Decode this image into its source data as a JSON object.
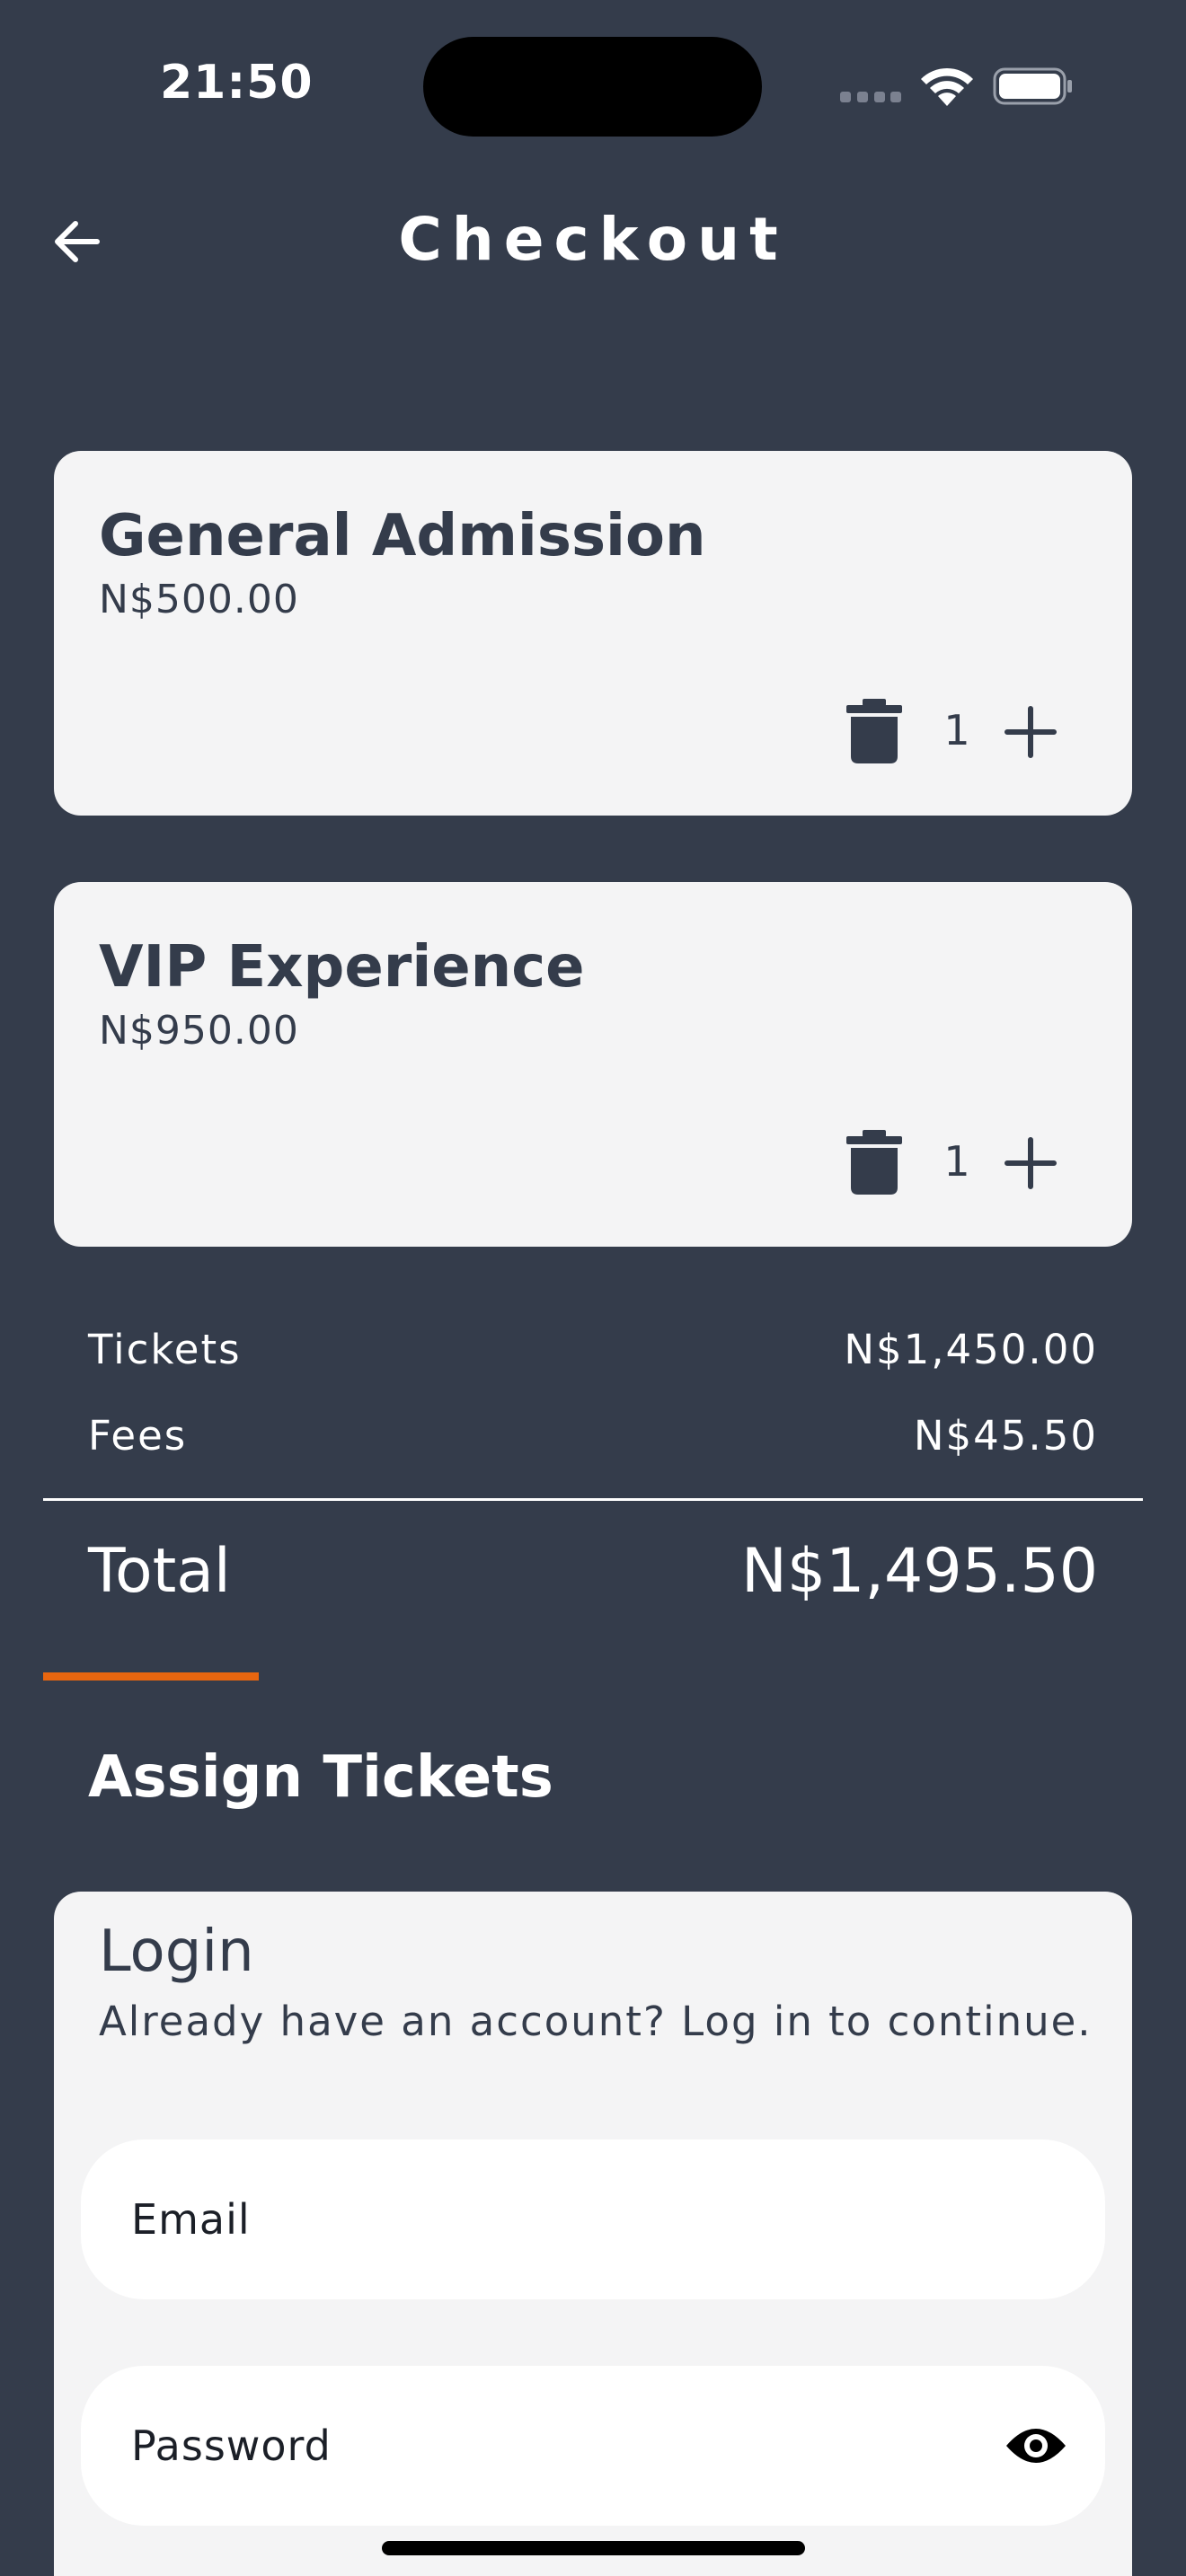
{
  "status_bar": {
    "time": "21:50"
  },
  "header": {
    "title": "Checkout",
    "back_icon": "arrow-left-icon"
  },
  "tickets": [
    {
      "name": "General Admission",
      "price": "N$500.00",
      "quantity": "1"
    },
    {
      "name": "VIP Experience",
      "price": "N$950.00",
      "quantity": "1"
    }
  ],
  "summary": {
    "tickets_label": "Tickets",
    "tickets_value": "N$1,450.00",
    "fees_label": "Fees",
    "fees_value": "N$45.50",
    "total_label": "Total",
    "total_value": "N$1,495.50"
  },
  "assign": {
    "title": "Assign Tickets",
    "login": {
      "title": "Login",
      "subtitle": "Already have an account? Log in to continue.",
      "email_placeholder": "Email",
      "password_placeholder": "Password"
    }
  },
  "colors": {
    "background": "#343c4b",
    "card": "#f4f4f5",
    "accent": "#e8660f",
    "text_dark": "#343c4b"
  }
}
